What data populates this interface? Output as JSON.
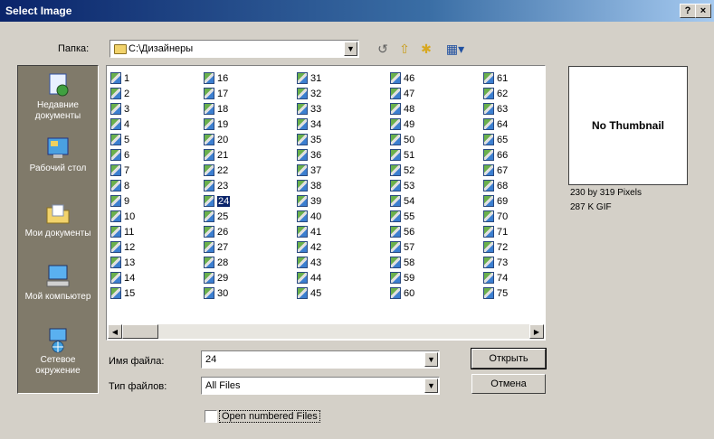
{
  "window": {
    "title": "Select Image",
    "help_label": "?",
    "close_label": "×"
  },
  "lookin": {
    "label": "Папка:",
    "value": "C:\\Дизайнеры"
  },
  "places": [
    {
      "label": "Недавние документы",
      "icon": "recent-documents-icon"
    },
    {
      "label": "Рабочий стол",
      "icon": "desktop-icon"
    },
    {
      "label": "Мои документы",
      "icon": "my-documents-icon"
    },
    {
      "label": "Мой компьютер",
      "icon": "my-computer-icon"
    },
    {
      "label": "Сетевое окружение",
      "icon": "network-places-icon"
    }
  ],
  "files": [
    "1",
    "2",
    "3",
    "4",
    "5",
    "6",
    "7",
    "8",
    "9",
    "10",
    "11",
    "12",
    "13",
    "14",
    "15",
    "16",
    "17",
    "18",
    "19",
    "20",
    "21",
    "22",
    "23",
    "24",
    "25",
    "26",
    "27",
    "28",
    "29",
    "30",
    "31",
    "32",
    "33",
    "34",
    "35",
    "36",
    "37",
    "38",
    "39",
    "40",
    "41",
    "42",
    "43",
    "44",
    "45",
    "46",
    "47",
    "48",
    "49",
    "50",
    "51",
    "52",
    "53",
    "54",
    "55",
    "56",
    "57",
    "58",
    "59",
    "60",
    "61",
    "62",
    "63",
    "64",
    "65",
    "66",
    "67",
    "68",
    "69",
    "70",
    "71",
    "72",
    "73",
    "74",
    "75"
  ],
  "selected_file": "24",
  "preview": {
    "text": "No Thumbnail",
    "dimensions": "230 by 319 Pixels",
    "info": "287 K  GIF"
  },
  "filename": {
    "label": "Имя файла:",
    "value": "24"
  },
  "filetype": {
    "label": "Тип файлов:",
    "value": "All Files"
  },
  "buttons": {
    "open": "Открыть",
    "cancel": "Отмена"
  },
  "checkbox": {
    "label": "Open numbered Files",
    "checked": false
  }
}
